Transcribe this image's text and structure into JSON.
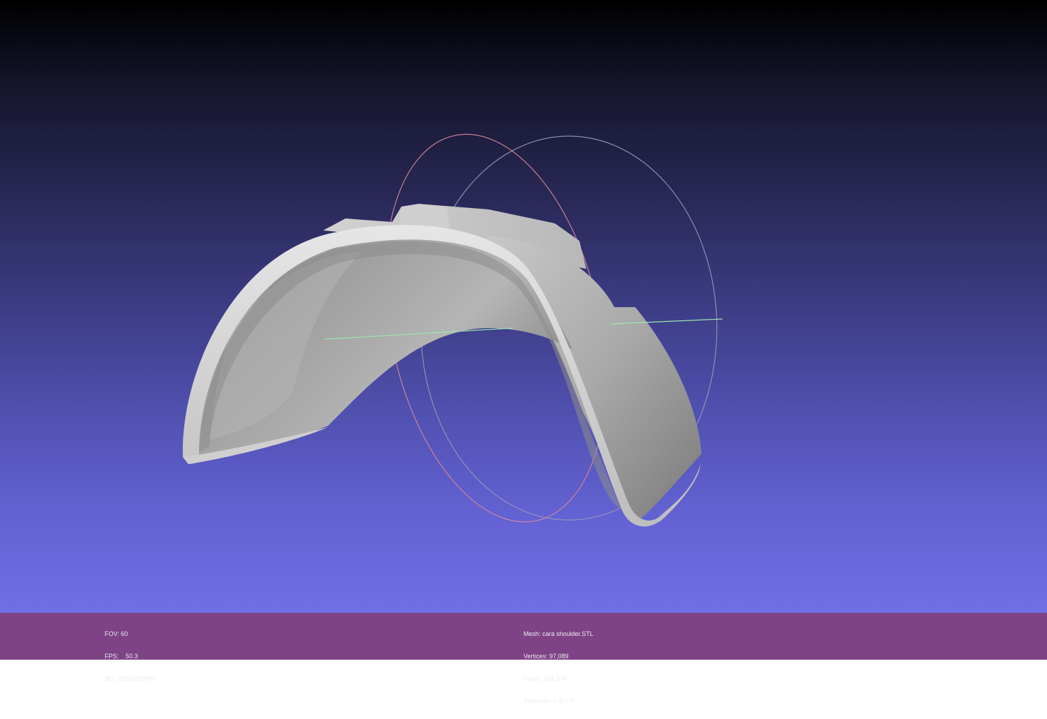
{
  "viewport": {
    "mesh_color": "#a9a9a9",
    "background_top": "#000000",
    "background_bottom": "#7070e6",
    "trackball_colors": {
      "red_ring": "#d88a9a",
      "gray_ring": "#a8a8c0",
      "green_axis": "#8fe0a0"
    }
  },
  "status_left": {
    "fov_label": "FOV: 60",
    "fps_label": "FPS:",
    "fps_value": "50.3",
    "render_mode": "BO_RENDERING"
  },
  "status_right": {
    "mesh": "Mesh: cara shoulder.STL",
    "vertices": "Vertices: 97,089",
    "faces": "Faces: 194,174",
    "selection": "Selection: v: 0 f: 0"
  }
}
